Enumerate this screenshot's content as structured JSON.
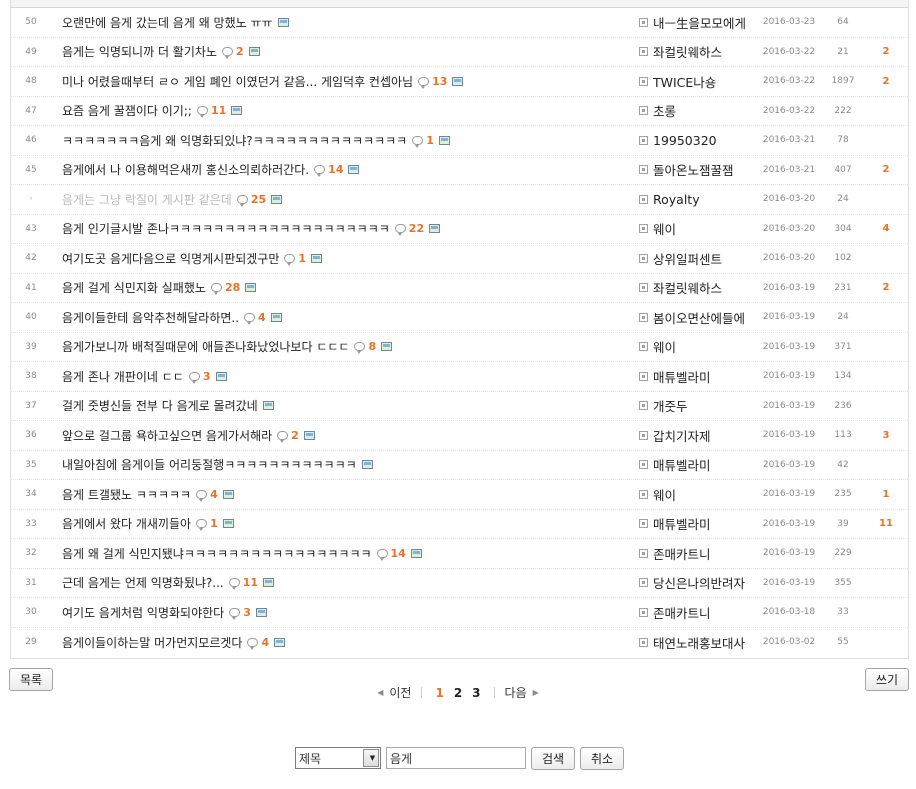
{
  "rows": [
    {
      "num": "50",
      "title": "오랜만에 음게 갔는데 음게 왜 망했노 ㅠㅠ",
      "comments": "",
      "img": true,
      "author": "내ㅡ生을모모에게",
      "date": "2016-03-23",
      "views": "64",
      "rec": "",
      "faded": false
    },
    {
      "num": "49",
      "title": "음게는 익명되니까 더 활기차노",
      "comments": "2",
      "img": true,
      "author": "좌컬릿웨하스",
      "date": "2016-03-22",
      "views": "21",
      "rec": "2",
      "faded": false
    },
    {
      "num": "48",
      "title": "미나 어렸을때부터 ㄹㅇ 게임 폐인 이였던거 같음... 게임덕후 컨셉아님",
      "comments": "13",
      "img": true,
      "author": "TWICE나숑",
      "date": "2016-03-22",
      "views": "1897",
      "rec": "2",
      "faded": false
    },
    {
      "num": "47",
      "title": "요즘 음게 꿀잼이다 이기;;",
      "comments": "11",
      "img": true,
      "author": "초롱",
      "date": "2016-03-22",
      "views": "222",
      "rec": "",
      "faded": false
    },
    {
      "num": "46",
      "title": "ㅋㅋㅋㅋㅋㅋㅋ음게 왜 익명화되있냐?ㅋㅋㅋㅋㅋㅋㅋㅋㅋㅋㅋㅋㅋㅋ",
      "comments": "1",
      "img": true,
      "author": "19950320",
      "date": "2016-03-21",
      "views": "78",
      "rec": "",
      "faded": false
    },
    {
      "num": "45",
      "title": "음게에서 나 이용해먹은새끼 홍신소의뢰하러간다.",
      "comments": "14",
      "img": true,
      "author": "돌아온노잼꿀잼",
      "date": "2016-03-21",
      "views": "407",
      "rec": "2",
      "faded": false
    },
    {
      "num": "›",
      "title": "음게는 그냥 락질이 게시판 같은데",
      "comments": "25",
      "img": true,
      "author": "Royalty",
      "date": "2016-03-20",
      "views": "24",
      "rec": "",
      "faded": true
    },
    {
      "num": "43",
      "title": "음게 인기글시발 존나ㅋㅋㅋㅋㅋㅋㅋㅋㅋㅋㅋㅋㅋㅋㅋㅋㅋㅋㅋㅋ",
      "comments": "22",
      "img": true,
      "author": "웨이",
      "date": "2016-03-20",
      "views": "304",
      "rec": "4",
      "faded": false
    },
    {
      "num": "42",
      "title": "여기도곳 음게다음으로 익명게시판되겠구만",
      "comments": "1",
      "img": true,
      "author": "상위일퍼센트",
      "date": "2016-03-20",
      "views": "102",
      "rec": "",
      "faded": false
    },
    {
      "num": "41",
      "title": "음게 걸게 식민지화 실패했노",
      "comments": "28",
      "img": true,
      "author": "좌컬릿웨하스",
      "date": "2016-03-19",
      "views": "231",
      "rec": "2",
      "faded": false
    },
    {
      "num": "40",
      "title": "음게이들한테 음악추천해달라하면..",
      "comments": "4",
      "img": true,
      "author": "봄이오면산에들에",
      "date": "2016-03-19",
      "views": "24",
      "rec": "",
      "faded": false
    },
    {
      "num": "39",
      "title": "음게가보니까 배척질때문에 애들존나화났었나보다 ㄷㄷㄷ",
      "comments": "8",
      "img": true,
      "author": "웨이",
      "date": "2016-03-19",
      "views": "371",
      "rec": "",
      "faded": false
    },
    {
      "num": "38",
      "title": "음게 존나 개판이네 ㄷㄷ",
      "comments": "3",
      "img": true,
      "author": "매튜벨라미",
      "date": "2016-03-19",
      "views": "134",
      "rec": "",
      "faded": false
    },
    {
      "num": "37",
      "title": "걸게 줏병신들 전부 다 음게로 몰려갔네",
      "comments": "",
      "img": true,
      "author": "개줏두",
      "date": "2016-03-19",
      "views": "236",
      "rec": "",
      "faded": false
    },
    {
      "num": "36",
      "title": "앞으로 걸그룹 욕하고싶으면 음게가서해라",
      "comments": "2",
      "img": true,
      "author": "갑치기자제",
      "date": "2016-03-19",
      "views": "113",
      "rec": "3",
      "faded": false
    },
    {
      "num": "35",
      "title": "내일아침에 음게이들 어리둥절행ㅋㅋㅋㅋㅋㅋㅋㅋㅋㅋㅋㅋ",
      "comments": "",
      "img": true,
      "author": "매튜벨라미",
      "date": "2016-03-19",
      "views": "42",
      "rec": "",
      "faded": false
    },
    {
      "num": "34",
      "title": "음게 트갤됐노 ㅋㅋㅋㅋㅋ",
      "comments": "4",
      "img": true,
      "author": "웨이",
      "date": "2016-03-19",
      "views": "235",
      "rec": "1",
      "faded": false
    },
    {
      "num": "33",
      "title": "음게에서 왔다 개새끼들아",
      "comments": "1",
      "img": true,
      "author": "매튜벨라미",
      "date": "2016-03-19",
      "views": "39",
      "rec": "11",
      "faded": false
    },
    {
      "num": "32",
      "title": "음게 왜 걸게 식민지됐냐ㅋㅋㅋㅋㅋㅋㅋㅋㅋㅋㅋㅋㅋㅋㅋㅋㅋ",
      "comments": "14",
      "img": true,
      "author": "존매카트니",
      "date": "2016-03-19",
      "views": "229",
      "rec": "",
      "faded": false
    },
    {
      "num": "31",
      "title": "근데 음게는 언제 익명화됬냐?...",
      "comments": "11",
      "img": true,
      "author": "당신은나의반려자",
      "date": "2016-03-19",
      "views": "355",
      "rec": "",
      "faded": false
    },
    {
      "num": "30",
      "title": "여기도 음게처럼 익명화되야한다",
      "comments": "3",
      "img": true,
      "author": "존매카트니",
      "date": "2016-03-18",
      "views": "33",
      "rec": "",
      "faded": false
    },
    {
      "num": "29",
      "title": "음게이들이하는말 머가먼지모르겟다",
      "comments": "4",
      "img": true,
      "author": "태연노래홍보대사",
      "date": "2016-03-02",
      "views": "55",
      "rec": "",
      "faded": false
    }
  ],
  "buttons": {
    "list": "목록",
    "write": "쓰기",
    "search": "검색",
    "cancel": "취소"
  },
  "pagination": {
    "prev": "이전",
    "next": "다음",
    "pages": [
      "1",
      "2",
      "3"
    ],
    "current": "1"
  },
  "search": {
    "scope": "제목",
    "query": "음게"
  },
  "colors": {
    "accent": "#e8722a",
    "meta": "#8a8a8a"
  },
  "icons": {
    "comment": "comment-bubble-icon",
    "image": "image-attachment-icon",
    "user": "user-icon",
    "select": "chevron-down-icon"
  }
}
